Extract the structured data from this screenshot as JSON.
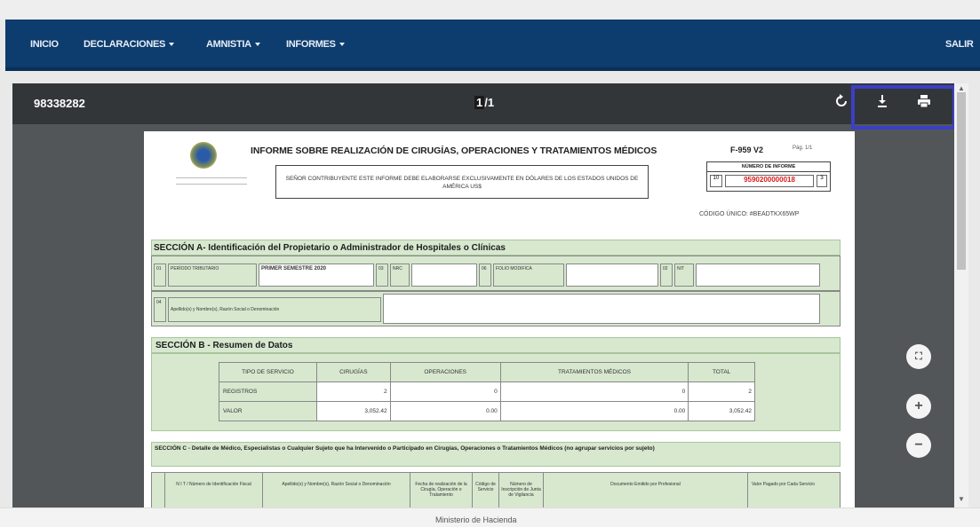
{
  "nav": {
    "items": [
      {
        "label": "INICIO",
        "caret": false
      },
      {
        "label": "DECLARACIONES",
        "caret": true
      },
      {
        "label": "AMNISTIA",
        "caret": true
      },
      {
        "label": "INFORMES",
        "caret": true
      }
    ],
    "exit_label": "SALIR"
  },
  "viewer": {
    "doc_id": "98338282",
    "page_current": "1",
    "page_total": "/1",
    "icons": {
      "rotate": "rotate-icon",
      "download": "download-icon",
      "print": "print-icon"
    }
  },
  "document": {
    "title": "INFORME SOBRE REALIZACIÓN DE CIRUGÍAS, OPERACIONES Y TRATAMIENTOS MÉDICOS",
    "form_code": "F-959 V2",
    "pag": "Pág. 1/1",
    "notice": "SEÑOR CONTRIBUYENTE ESTE INFORME DEBE ELABORARSE EXCLUSIVAMENTE EN DÓLARES DE LOS ESTADOS UNIDOS DE AMÉRICA US$",
    "numero_head": "NÚMERO DE INFORME",
    "numero_prefix": "10",
    "numero_value": "9590200000018",
    "numero_suffix": "3",
    "unique_code": "CÓDIGO ÚNICO: #BEADTKX65WP",
    "section_a": {
      "title": "SECCIÓN A- Identificación del Propietario o Administrador de Hospitales o Clínicas",
      "period_code": "01",
      "period_label": "PERÍODO TRIBUTARIO",
      "period_value": "PRIMER SEMESTRE 2020",
      "nrc_code": "03",
      "nrc_label": "NRC",
      "folio_code": "06",
      "folio_label": "FOLIO MODIFICA",
      "nit_code": "02",
      "nit_label": "NIT",
      "name_code": "04",
      "name_label": "Apellido(s) y Nombre(s), Razón Social o Denominación"
    },
    "section_b": {
      "title": "SECCIÓN B - Resumen de Datos",
      "headers": [
        "TIPO DE SERVICIO",
        "CIRUGÍAS",
        "OPERACIONES",
        "TRATAMIENTOS MÉDICOS",
        "TOTAL"
      ],
      "rows": [
        {
          "label": "REGISTROS",
          "values": [
            "2",
            "0",
            "0",
            "2"
          ]
        },
        {
          "label": "VALOR",
          "values": [
            "3,052.42",
            "0.00",
            "0.00",
            "3,052.42"
          ]
        }
      ]
    },
    "section_c": {
      "title": "SECCIÓN C - Detalle de Médico, Especialistas o Cualquier Sujeto que ha Intervenido o Participado en Cirugías, Operaciones o Tratamientos Médicos (no agrupar servicios por sujeto)",
      "headers": [
        "N I T / Número de Identificación Fiscal",
        "Apellido(s) y Nombre(s), Razón Social o Denominación",
        "Fecha de realización de la Cirugía, Operación o Tratamiento",
        "Código de Servicio",
        "Número de Inscripción de Junta de Vigilancia",
        "Documento Emitido por Profesional",
        "Valor Pagado por Cada Servicio"
      ]
    }
  },
  "fabs": {
    "fit": "fit-icon",
    "zoom_in": "+",
    "zoom_out": "−"
  },
  "footer": {
    "text": "Ministerio de Hacienda"
  }
}
